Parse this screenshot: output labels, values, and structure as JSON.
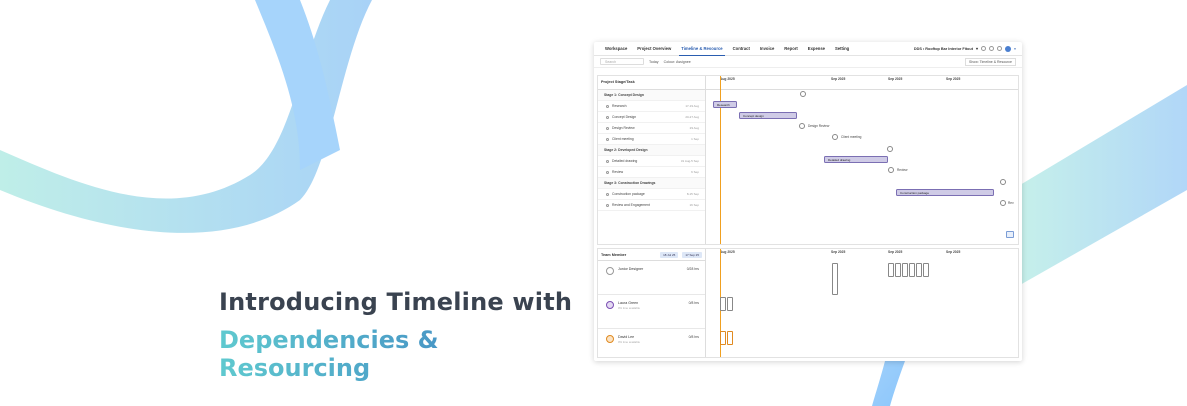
{
  "headline": {
    "line1": "Introducing Timeline with",
    "line2": "Dependencies & Resourcing"
  },
  "colors": {
    "accent": "#2a5db0",
    "bar": "#cfcbe6",
    "today": "#f0a020",
    "gradient_start": "#5fc9cf",
    "gradient_end": "#3a78c0"
  },
  "nav": {
    "tabs": [
      "Workspace",
      "Project Overview",
      "Timeline & Resource",
      "Contract",
      "Invoice",
      "Report",
      "Expense",
      "Setting"
    ],
    "active_tab": "Timeline & Resource",
    "project": "DDS • Rooftop Bar Interior Fitout"
  },
  "toolbar": {
    "search_placeholder": "Search",
    "today_label": "Today",
    "colour_label": "Colour: Assignee",
    "show_label": "Show: Timeline & Resource"
  },
  "gantt": {
    "header": "Project Stage/Task",
    "months": [
      "Aug 2025",
      "Sep 2025",
      "Sep 2025",
      "Sep 2025"
    ],
    "rows": [
      {
        "type": "stage",
        "label": "Stage 1: Concept Design",
        "date": ""
      },
      {
        "type": "task",
        "label": "Research",
        "date": "17-19 Aug"
      },
      {
        "type": "task",
        "label": "Concept Design",
        "date": "20-27 Aug"
      },
      {
        "type": "milestone",
        "label": "Design Review",
        "date": "29 Aug"
      },
      {
        "type": "milestone",
        "label": "Client meeting",
        "date": "1 Sep"
      },
      {
        "type": "stage",
        "label": "Stage 2: Developed Design",
        "date": ""
      },
      {
        "type": "task",
        "label": "Detailed drawing",
        "date": "31 Aug-5 Sep"
      },
      {
        "type": "milestone",
        "label": "Review",
        "date": "6 Sep"
      },
      {
        "type": "stage",
        "label": "Stage 3: Construction Drawings",
        "date": ""
      },
      {
        "type": "task",
        "label": "Construction package",
        "date": "8-15 Sep"
      },
      {
        "type": "milestone",
        "label": "Review and Engagement",
        "date": "16 Sep"
      }
    ],
    "bars": {
      "research": "Research",
      "concept": "Concept design",
      "design_review": "Design Review",
      "client": "Client meeting",
      "detailed": "Detailed drawing",
      "review": "Review",
      "construction": "Construction package",
      "rev2": "Rev"
    }
  },
  "resource": {
    "header": "Team Member",
    "range_start": "18 Jul 25",
    "range_end": "17 Sep 25",
    "people": [
      {
        "name": "Junior Designer",
        "sub": "",
        "hours": "0/28 hrs"
      },
      {
        "name": "Laura Green",
        "sub": "0% time available",
        "hours": "0/8 hrs"
      },
      {
        "name": "David Lee",
        "sub": "0% time available",
        "hours": "0/8 hrs"
      }
    ]
  }
}
